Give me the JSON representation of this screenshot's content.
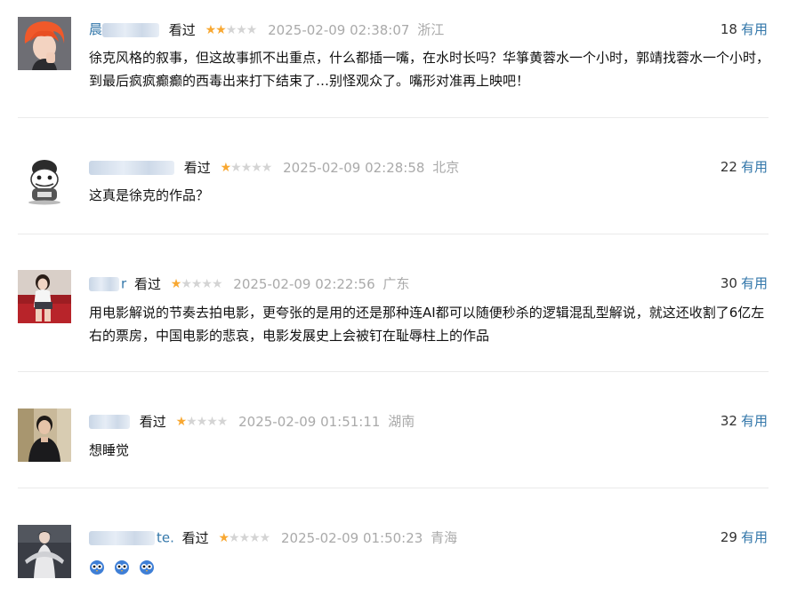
{
  "comments": [
    {
      "user_suffix": "",
      "status": "看过",
      "rating": 2,
      "time": "2025-02-09 02:38:07",
      "location": "浙江",
      "votes": "18",
      "useful_label": "有用",
      "text": "徐克风格的叙事，但这故事抓不出重点，什么都插一嘴，在水时长吗？华箏黄蓉水一个小时，郭靖找蓉水一个小时，到最后疯疯癫癫的西毒出来打下结束了…别怪观众了。嘴形对准再上映吧！",
      "avatar_icon": "orange-hair-avatar"
    },
    {
      "user_suffix": "",
      "status": "看过",
      "rating": 1,
      "time": "2025-02-09 02:28:58",
      "location": "北京",
      "votes": "22",
      "useful_label": "有用",
      "text": "这真是徐克的作品？",
      "avatar_icon": "cartoon-sketch-avatar"
    },
    {
      "user_suffix": "r",
      "status": "看过",
      "rating": 1,
      "time": "2025-02-09 02:22:56",
      "location": "广东",
      "votes": "30",
      "useful_label": "有用",
      "text": "用电影解说的节奏去拍电影，更夸张的是用的还是那种连AI都可以随便秒杀的逻辑混乱型解说，就这还收割了6亿左右的票房，中国电影的悲哀，电影发展史上会被钉在耻辱柱上的作品",
      "avatar_icon": "girl-red-sofa-avatar"
    },
    {
      "user_suffix": "",
      "status": "看过",
      "rating": 1,
      "time": "2025-02-09 01:51:11",
      "location": "湖南",
      "votes": "32",
      "useful_label": "有用",
      "text": "想睡觉",
      "avatar_icon": "man-in-black-avatar"
    },
    {
      "user_suffix": "te.",
      "status": "看过",
      "rating": 1,
      "time": "2025-02-09 01:50:23",
      "location": "青海",
      "votes": "29",
      "useful_label": "有用",
      "text": "",
      "emoji_icon": "blue-owl-emoji",
      "avatar_icon": "hanfu-figure-avatar"
    }
  ]
}
